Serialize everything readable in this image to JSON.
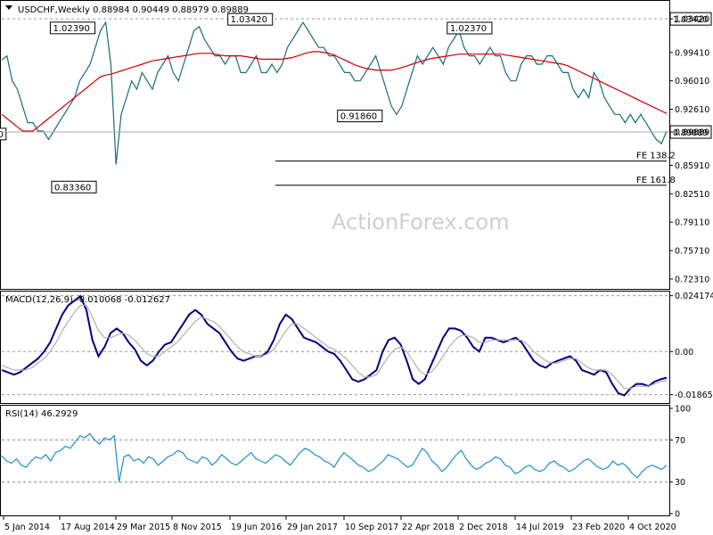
{
  "chart_data": [
    {
      "type": "line",
      "title": "USDCHF,Weekly  0.88984 0.90449 0.88979 0.89889",
      "watermark": "ActionForex.com",
      "ylim": [
        0.7134,
        1.0525
      ],
      "y_ticks": [
        "1.03420",
        "0.99410",
        "0.96010",
        "0.92610",
        "0.89889",
        "0.85910",
        "0.82510",
        "0.79110",
        "0.75710",
        "0.72310"
      ],
      "y_tick_values": [
        1.0342,
        0.9941,
        0.9601,
        0.9261,
        0.89889,
        0.8591,
        0.8251,
        0.7911,
        0.7571,
        0.7231
      ],
      "x_tick_labels": [
        "5 Jan 2014",
        "17 Aug 2014",
        "29 Mar 2015",
        "8 Nov 2015",
        "19 Jun 2016",
        "29 Jan 2017",
        "10 Sep 2017",
        "22 Apr 2018",
        "2 Dec 2018",
        "14 Jul 2019",
        "23 Feb 2020",
        "4 Oct 2020"
      ],
      "series": [
        {
          "values": [
            0.985,
            0.99,
            0.96,
            0.95,
            0.93,
            0.91,
            0.91,
            0.9,
            0.9,
            0.89,
            0.9,
            0.91,
            0.92,
            0.93,
            0.94,
            0.96,
            0.97,
            0.98,
            1.0,
            1.02,
            1.03,
            0.98,
            0.86,
            0.92,
            0.94,
            0.96,
            0.95,
            0.97,
            0.96,
            0.95,
            0.97,
            0.98,
            0.99,
            0.97,
            0.96,
            0.98,
            1.0,
            1.02,
            1.025,
            1.01,
            1.0,
            0.99,
            0.99,
            0.98,
            0.99,
            0.99,
            0.97,
            0.97,
            0.98,
            0.99,
            0.97,
            0.97,
            0.98,
            0.97,
            0.98,
            1.0,
            1.01,
            1.02,
            1.03,
            1.02,
            1.01,
            1.0,
            1.0,
            0.99,
            0.99,
            0.98,
            0.97,
            0.97,
            0.96,
            0.96,
            0.97,
            0.98,
            0.99,
            0.97,
            0.95,
            0.93,
            0.92,
            0.93,
            0.95,
            0.97,
            0.99,
            0.98,
            0.99,
            1.0,
            0.99,
            0.98,
            1.0,
            1.01,
            1.02,
            1.0,
            0.99,
            0.99,
            0.98,
            0.99,
            1.0,
            0.99,
            0.99,
            0.97,
            0.96,
            0.96,
            0.98,
            0.99,
            0.99,
            0.98,
            0.98,
            0.99,
            0.99,
            0.98,
            0.97,
            0.97,
            0.95,
            0.94,
            0.95,
            0.94,
            0.97,
            0.96,
            0.94,
            0.93,
            0.92,
            0.92,
            0.91,
            0.92,
            0.91,
            0.92,
            0.91,
            0.9,
            0.89,
            0.885,
            0.9
          ],
          "color": "#1a6a7a"
        },
        {
          "values": [
            0.92,
            0.915,
            0.91,
            0.905,
            0.9,
            0.9,
            0.9,
            0.905,
            0.91,
            0.915,
            0.92,
            0.925,
            0.93,
            0.935,
            0.94,
            0.945,
            0.95,
            0.955,
            0.96,
            0.965,
            0.967,
            0.968,
            0.97,
            0.972,
            0.974,
            0.976,
            0.978,
            0.98,
            0.982,
            0.984,
            0.985,
            0.986,
            0.987,
            0.988,
            0.989,
            0.99,
            0.991,
            0.992,
            0.993,
            0.993,
            0.993,
            0.992,
            0.991,
            0.99,
            0.99,
            0.99,
            0.99,
            0.989,
            0.988,
            0.987,
            0.986,
            0.986,
            0.986,
            0.986,
            0.986,
            0.987,
            0.988,
            0.99,
            0.992,
            0.994,
            0.995,
            0.995,
            0.994,
            0.993,
            0.991,
            0.988,
            0.985,
            0.982,
            0.979,
            0.977,
            0.975,
            0.974,
            0.973,
            0.973,
            0.973,
            0.973,
            0.974,
            0.976,
            0.978,
            0.98,
            0.982,
            0.984,
            0.986,
            0.987,
            0.988,
            0.989,
            0.99,
            0.991,
            0.992,
            0.992,
            0.992,
            0.992,
            0.992,
            0.992,
            0.992,
            0.992,
            0.992,
            0.991,
            0.99,
            0.989,
            0.988,
            0.987,
            0.986,
            0.985,
            0.984,
            0.983,
            0.982,
            0.981,
            0.98,
            0.978,
            0.975,
            0.972,
            0.969,
            0.966,
            0.963,
            0.96,
            0.957,
            0.954,
            0.951,
            0.948,
            0.945,
            0.942,
            0.939,
            0.936,
            0.933,
            0.93,
            0.927,
            0.924,
            0.921
          ],
          "color": "#cc0000"
        }
      ],
      "annotations": [
        {
          "text": "1.02390",
          "value": 1.0239
        },
        {
          "text": "1.03420",
          "value": 1.0342
        },
        {
          "text": "1.02370",
          "value": 1.0237
        },
        {
          "text": "0.91860",
          "value": 0.9186
        },
        {
          "text": "0.83360",
          "value": 0.8336
        },
        {
          "text": "0",
          "value": 0.897
        },
        {
          "text": "FE 138.2",
          "value": 0.8641
        },
        {
          "text": "FE 161.8",
          "value": 0.8352
        }
      ],
      "current_price": {
        "text": "0.89889",
        "value": 0.89889
      },
      "top_tag": {
        "text": "1.03420",
        "value": 1.0342
      },
      "top_value_partial": "1.03420"
    },
    {
      "type": "line",
      "title": "MACD(12,26,9) -0.010068 -0.012627",
      "ylim": [
        -0.0215,
        0.0248
      ],
      "y_ticks": [
        "0.024174",
        "0.00",
        "-0.018653"
      ],
      "y_tick_values": [
        0.024174,
        0.0,
        -0.018653
      ],
      "series": [
        {
          "values": [
            -0.008,
            -0.009,
            -0.01,
            -0.009,
            -0.007,
            -0.005,
            -0.003,
            0.0,
            0.004,
            0.01,
            0.016,
            0.02,
            0.022,
            0.024,
            0.018,
            0.005,
            -0.002,
            0.002,
            0.008,
            0.01,
            0.008,
            0.004,
            0.001,
            -0.004,
            -0.006,
            -0.004,
            0.0,
            0.003,
            0.004,
            0.008,
            0.012,
            0.016,
            0.018,
            0.016,
            0.012,
            0.01,
            0.008,
            0.004,
            0.0,
            -0.003,
            -0.004,
            -0.003,
            -0.002,
            -0.002,
            0.0,
            0.005,
            0.012,
            0.016,
            0.014,
            0.01,
            0.006,
            0.005,
            0.004,
            0.002,
            0.0,
            -0.001,
            -0.004,
            -0.008,
            -0.012,
            -0.013,
            -0.012,
            -0.01,
            -0.008,
            0.0,
            0.005,
            0.006,
            0.003,
            -0.004,
            -0.012,
            -0.014,
            -0.012,
            -0.006,
            0.0,
            0.006,
            0.01,
            0.01,
            0.009,
            0.006,
            0.002,
            0.0,
            0.006,
            0.006,
            0.005,
            0.004,
            0.005,
            0.006,
            0.004,
            0.0,
            -0.004,
            -0.006,
            -0.007,
            -0.005,
            -0.004,
            -0.003,
            -0.002,
            -0.004,
            -0.008,
            -0.009,
            -0.01,
            -0.008,
            -0.009,
            -0.014,
            -0.018,
            -0.019,
            -0.016,
            -0.014,
            -0.014,
            -0.015,
            -0.013,
            -0.012,
            -0.0113
          ],
          "color": "#000080"
        },
        {
          "values": [
            -0.006,
            -0.007,
            -0.008,
            -0.008,
            -0.008,
            -0.007,
            -0.005,
            -0.003,
            0.0,
            0.004,
            0.009,
            0.013,
            0.017,
            0.02,
            0.02,
            0.015,
            0.009,
            0.006,
            0.006,
            0.007,
            0.008,
            0.007,
            0.005,
            0.002,
            -0.001,
            -0.002,
            -0.002,
            0.0,
            0.002,
            0.004,
            0.007,
            0.01,
            0.013,
            0.015,
            0.014,
            0.013,
            0.011,
            0.008,
            0.005,
            0.002,
            0.0,
            -0.001,
            -0.002,
            -0.002,
            -0.001,
            0.001,
            0.005,
            0.009,
            0.012,
            0.012,
            0.01,
            0.008,
            0.006,
            0.004,
            0.002,
            0.001,
            -0.001,
            -0.003,
            -0.006,
            -0.009,
            -0.011,
            -0.011,
            -0.01,
            -0.006,
            -0.002,
            0.001,
            0.002,
            0.0,
            -0.004,
            -0.008,
            -0.01,
            -0.009,
            -0.006,
            -0.002,
            0.002,
            0.005,
            0.007,
            0.007,
            0.006,
            0.004,
            0.004,
            0.005,
            0.005,
            0.005,
            0.005,
            0.005,
            0.005,
            0.003,
            0.0,
            -0.002,
            -0.004,
            -0.005,
            -0.005,
            -0.004,
            -0.003,
            -0.003,
            -0.005,
            -0.007,
            -0.008,
            -0.008,
            -0.008,
            -0.01,
            -0.013,
            -0.016,
            -0.016,
            -0.015,
            -0.015,
            -0.015,
            -0.014,
            -0.013,
            -0.0126
          ],
          "color": "#b0b0b0"
        }
      ]
    },
    {
      "type": "line",
      "title": "RSI(14) 46.2929",
      "ylim": [
        0,
        100
      ],
      "y_ticks": [
        "100",
        "70",
        "30",
        "0"
      ],
      "y_tick_values": [
        100,
        70,
        30,
        0
      ],
      "series": [
        {
          "values": [
            55,
            50,
            48,
            52,
            46,
            44,
            50,
            54,
            52,
            56,
            50,
            58,
            60,
            64,
            62,
            68,
            74,
            72,
            76,
            70,
            66,
            72,
            70,
            74,
            30,
            54,
            56,
            50,
            52,
            48,
            54,
            52,
            46,
            50,
            54,
            56,
            60,
            58,
            52,
            50,
            48,
            54,
            52,
            46,
            50,
            56,
            52,
            48,
            46,
            50,
            54,
            58,
            52,
            50,
            48,
            52,
            56,
            54,
            50,
            46,
            52,
            58,
            62,
            60,
            56,
            54,
            50,
            48,
            44,
            52,
            58,
            54,
            50,
            46,
            44,
            40,
            42,
            46,
            50,
            56,
            54,
            52,
            48,
            44,
            46,
            54,
            62,
            58,
            50,
            46,
            40,
            44,
            50,
            56,
            60,
            52,
            46,
            42,
            44,
            48,
            50,
            54,
            52,
            46,
            44,
            38,
            40,
            44,
            46,
            42,
            40,
            42,
            48,
            50,
            46,
            44,
            40,
            42,
            46,
            50,
            52,
            48,
            44,
            42,
            44,
            50,
            46,
            48,
            44,
            38,
            34,
            40,
            44,
            46,
            44,
            42,
            46
          ],
          "color": "#1e90c8"
        }
      ]
    }
  ]
}
